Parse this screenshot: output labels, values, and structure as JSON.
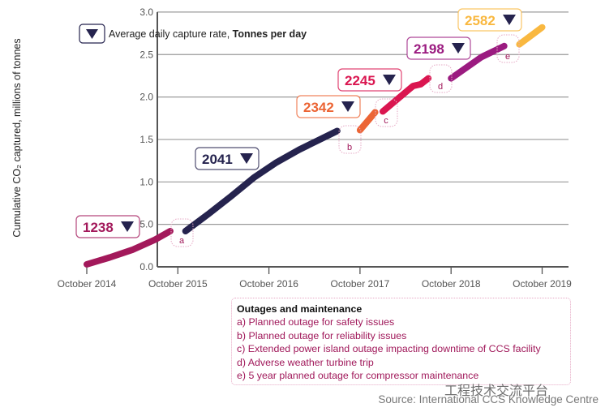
{
  "chart_data": {
    "type": "line",
    "title": "",
    "ylabel": "Cumulative CO₂ captured, millions of tonnes",
    "xlabel": "",
    "ylim": [
      0,
      3.0
    ],
    "y_ticks": [
      "0.0",
      "5.0",
      "1.0",
      "1.5",
      "2.0",
      "2.5",
      "3.0"
    ],
    "x_ticks": [
      "October 2014",
      "October 2015",
      "October 2016",
      "October 2017",
      "October 2018",
      "October 2019"
    ],
    "grid": true,
    "legend": {
      "text": "Average daily capture rate, ",
      "bold": "Tonnes per day",
      "placement": "top-left"
    },
    "series": [
      {
        "label": "1238",
        "color": "#a3195b",
        "points": [
          [
            "2014-10",
            0.03
          ],
          [
            "2015-01",
            0.11
          ],
          [
            "2015-04",
            0.2
          ],
          [
            "2015-07",
            0.32
          ],
          [
            "2015-09",
            0.42
          ]
        ]
      },
      {
        "label": "2041",
        "color": "#25234e",
        "points": [
          [
            "2015-11",
            0.42
          ],
          [
            "2016-02",
            0.62
          ],
          [
            "2016-05",
            0.83
          ],
          [
            "2016-08",
            1.05
          ],
          [
            "2016-11",
            1.23
          ],
          [
            "2017-02",
            1.38
          ],
          [
            "2017-07",
            1.6
          ]
        ]
      },
      {
        "label": "2342",
        "color": "#ec6535",
        "points": [
          [
            "2017-10",
            1.61
          ],
          [
            "2017-12",
            1.82
          ]
        ]
      },
      {
        "label": "2245",
        "color": "#da1650",
        "points": [
          [
            "2018-01",
            1.83
          ],
          [
            "2018-05",
            2.13
          ],
          [
            "2018-06",
            2.15
          ],
          [
            "2018-07",
            2.22
          ]
        ]
      },
      {
        "label": "2198",
        "color": "#9b1b80",
        "points": [
          [
            "2018-10",
            2.22
          ],
          [
            "2019-02",
            2.47
          ],
          [
            "2019-05",
            2.6
          ]
        ]
      },
      {
        "label": "2582",
        "color": "#f9b840",
        "points": [
          [
            "2019-07",
            2.62
          ],
          [
            "2019-10",
            2.82
          ]
        ]
      }
    ],
    "gap_markers": [
      "a",
      "b",
      "c",
      "d",
      "e"
    ]
  },
  "outages": {
    "title": "Outages and maintenance",
    "items": [
      "a) Planned outage for safety issues",
      "b) Planned outage for reliability issues",
      "c) Extended power island outage impacting downtime of CCS facility",
      "d) Adverse weather turbine trip",
      "e) 5 year planned outage for compressor maintenance"
    ]
  },
  "watermark": "工程技术交流平台",
  "source": "Source: International CCS Knowledge Centre",
  "colors": {
    "axis": "#555555",
    "grid": "#9a9a9a",
    "gap_marker": "#e6a8c4",
    "triangle": "#25234e"
  }
}
